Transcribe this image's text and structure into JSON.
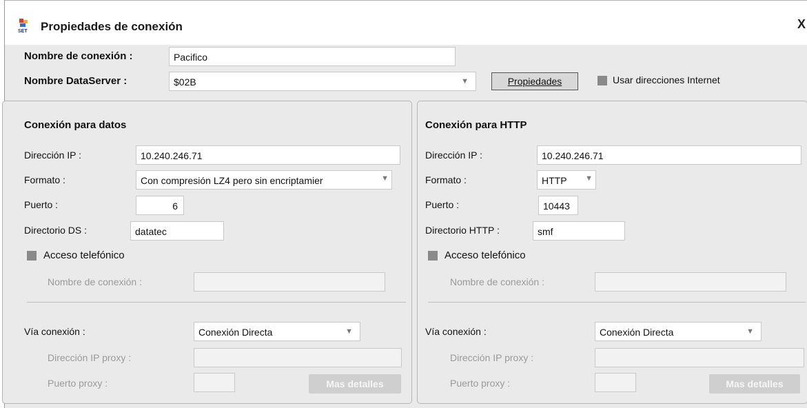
{
  "dialog": {
    "title": "Propiedades de conexión",
    "close_glyph": "X",
    "icon": "app-logo-icon"
  },
  "top": {
    "connection_name_label": "Nombre de conexión :",
    "connection_name_value": "Pacifico",
    "dataserver_label": "Nombre DataServer :",
    "dataserver_value": "$02B",
    "properties_button": "Propiedades",
    "internet_label": "Usar direcciones Internet"
  },
  "data_panel": {
    "heading": "Conexión para datos",
    "ip_label": "Dirección IP :",
    "ip_value": "10.240.246.71",
    "format_label": "Formato :",
    "format_value": "Con compresión LZ4 pero sin encriptamier",
    "port_label": "Puerto :",
    "port_value": "6",
    "dir_label": "Directorio DS :",
    "dir_value": "datatec",
    "phone_label": "Acceso telefónico",
    "phone_name_label": "Nombre de conexión :",
    "via_label": "Vía conexión :",
    "via_value": "Conexión Directa",
    "proxy_ip_label": "Dirección IP proxy :",
    "proxy_port_label": "Puerto proxy :",
    "details_button": "Mas detalles"
  },
  "http_panel": {
    "heading": "Conexión para HTTP",
    "ip_label": "Dirección IP :",
    "ip_value": "10.240.246.71",
    "format_label": "Formato :",
    "format_value": "HTTP",
    "port_label": "Puerto :",
    "port_value": "10443",
    "dir_label": "Directorio HTTP :",
    "dir_value": "smf",
    "phone_label": "Acceso telefónico",
    "phone_name_label": "Nombre de conexión :",
    "via_label": "Vía conexión :",
    "via_value": "Conexión Directa",
    "proxy_ip_label": "Dirección IP proxy :",
    "proxy_port_label": "Puerto proxy :",
    "details_button": "Mas detalles"
  },
  "colors": {
    "body_bg": "#eaeaea",
    "checkbox": "#8a8a8a",
    "disabled_text": "#9a9a9a"
  }
}
